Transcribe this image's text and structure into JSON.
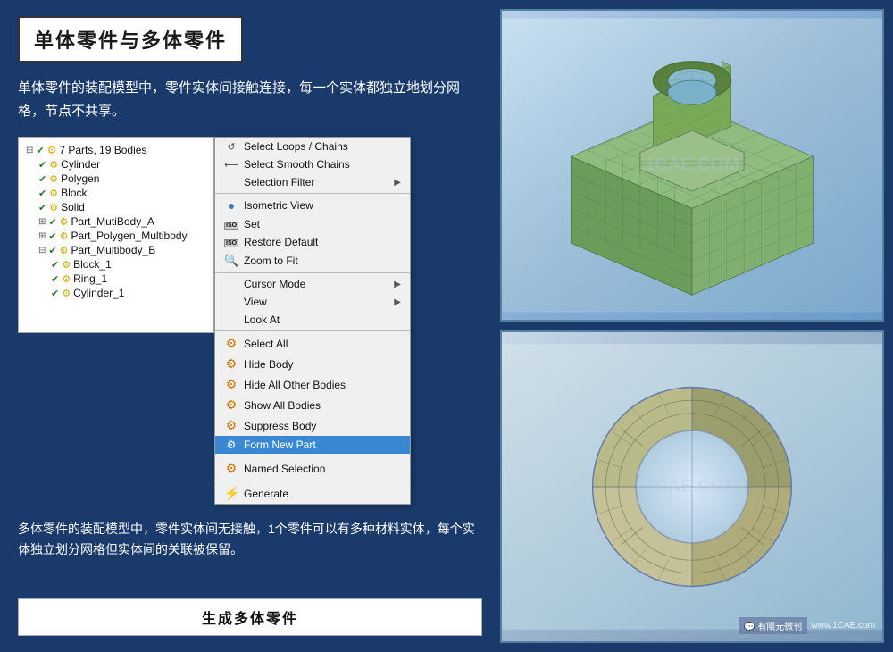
{
  "title": "单体零件与多体零件",
  "desc_top": "单体零件的装配模型中，零件实体间接触连接，每一个实体都独立地划分网格，节点不共享。",
  "tree": {
    "root": "7 Parts, 19 Bodies",
    "items": [
      {
        "label": "Cylinder",
        "indent": 1,
        "check": true
      },
      {
        "label": "Polygen",
        "indent": 1,
        "check": true
      },
      {
        "label": "Block",
        "indent": 1,
        "check": true
      },
      {
        "label": "Solid",
        "indent": 1,
        "check": true
      },
      {
        "label": "Part_MutiBody_A",
        "indent": 1,
        "check": true,
        "expand": true
      },
      {
        "label": "Part_Polygen_Multibody",
        "indent": 1,
        "check": true,
        "expand": true
      },
      {
        "label": "Part_Multibody_B",
        "indent": 1,
        "check": true,
        "expand": false
      },
      {
        "label": "Block_1",
        "indent": 2,
        "check": true
      },
      {
        "label": "Ring_1",
        "indent": 2,
        "check": true
      },
      {
        "label": "Cylinder_1",
        "indent": 2,
        "check": true
      }
    ]
  },
  "context_menu": {
    "items": [
      {
        "label": "Select Loops / Chains",
        "icon": "loop",
        "has_arrow": false
      },
      {
        "label": "Select Smooth Chains",
        "icon": "smooth",
        "has_arrow": false
      },
      {
        "label": "Selection Filter",
        "icon": null,
        "has_arrow": true
      },
      {
        "type": "separator"
      },
      {
        "label": "Isometric View",
        "icon": "circle-blue",
        "has_arrow": false
      },
      {
        "label": "Set",
        "icon": "iso-box",
        "has_arrow": false
      },
      {
        "label": "Restore Default",
        "icon": "iso-box2",
        "has_arrow": false
      },
      {
        "label": "Zoom to Fit",
        "icon": "zoom",
        "has_arrow": false
      },
      {
        "type": "separator"
      },
      {
        "label": "Cursor Mode",
        "icon": null,
        "has_arrow": true
      },
      {
        "label": "View",
        "icon": null,
        "has_arrow": true
      },
      {
        "label": "Look At",
        "icon": null,
        "has_arrow": false
      },
      {
        "type": "separator"
      },
      {
        "label": "Select All",
        "icon": "select-all",
        "has_arrow": false
      },
      {
        "label": "Hide Body",
        "icon": "hide",
        "has_arrow": false
      },
      {
        "label": "Hide All Other Bodies",
        "icon": "hide2",
        "has_arrow": false
      },
      {
        "label": "Show All Bodies",
        "icon": "show",
        "has_arrow": false
      },
      {
        "label": "Suppress Body",
        "icon": "suppress",
        "has_arrow": false
      },
      {
        "label": "Form New Part",
        "icon": "form",
        "has_arrow": false,
        "highlighted": true
      },
      {
        "type": "separator"
      },
      {
        "label": "Named Selection",
        "icon": "named",
        "has_arrow": false
      },
      {
        "type": "separator"
      },
      {
        "label": "Generate",
        "icon": "generate",
        "has_arrow": false
      }
    ]
  },
  "desc_bottom": "多体零件的装配模型中，零件实体间无接触，1个零件可以有多种材料实体，每个实体独立划分网格但实体间的关联被保留。",
  "bottom_label": "生成多体零件",
  "watermark_top": "1CAE.COM",
  "watermark_bottom": "1CAE.COM",
  "corner": {
    "icon": "wechat-icon",
    "text": "有限元微刊",
    "url": "www.1CAE.com"
  }
}
